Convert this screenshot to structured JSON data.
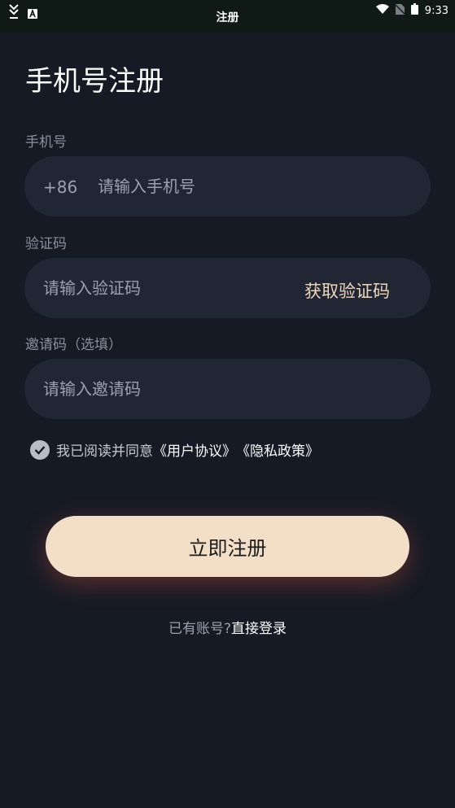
{
  "status_bar": {
    "title": "注册",
    "time": "9:33",
    "left_icons": [
      "double-chevron-icon",
      "a-badge-icon"
    ],
    "right_icons": [
      "wifi-icon",
      "no-sim-icon",
      "battery-icon"
    ]
  },
  "page": {
    "title": "手机号注册"
  },
  "phone": {
    "label": "手机号",
    "prefix": "+86",
    "placeholder": "请输入手机号"
  },
  "code": {
    "label": "验证码",
    "placeholder": "请输入验证码",
    "get_code_label": "获取验证码"
  },
  "invite": {
    "label": "邀请码（选填）",
    "placeholder": "请输入邀请码"
  },
  "agreement": {
    "checked": true,
    "prefix_text": "我已阅读并同意",
    "user_agreement": "《用户协议》",
    "privacy_policy": "《隐私政策》"
  },
  "actions": {
    "register_label": "立即注册",
    "have_account_text": "已有账号?",
    "login_link": "直接登录"
  },
  "colors": {
    "background": "#161a25",
    "field_bg": "#212634",
    "accent": "#f3dec7",
    "accent_text": "#efd6bd"
  }
}
